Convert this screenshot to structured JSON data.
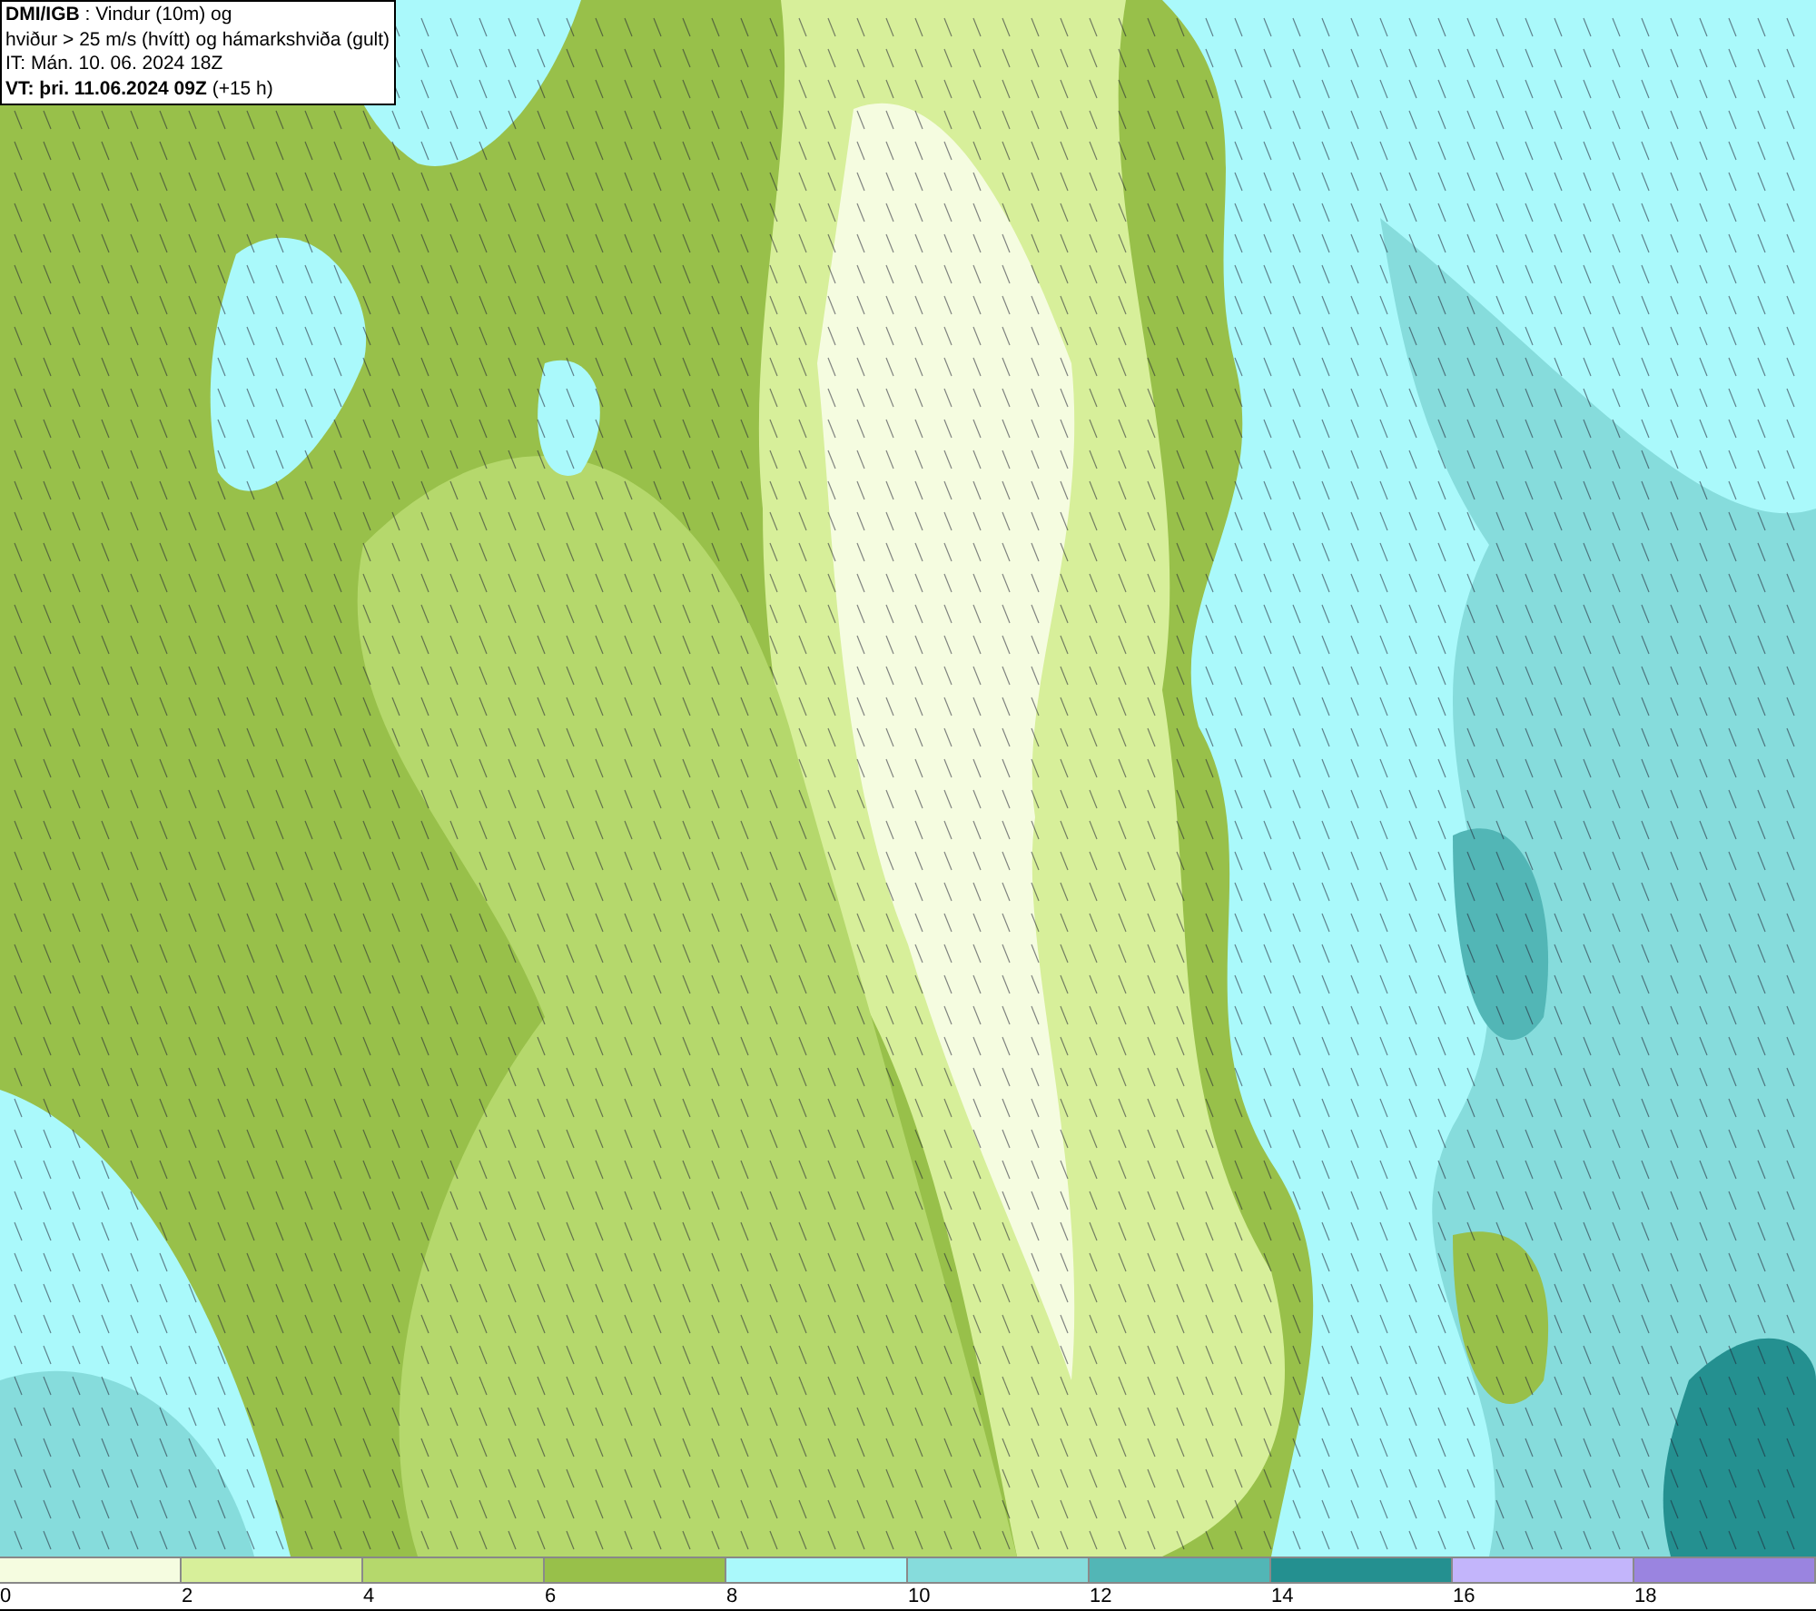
{
  "title_box": {
    "lines": [
      "**DMI/IGB** : Vindur (10m) og",
      "hviður > 25 m/s (hvítt) og hámarkshviða (gult)",
      "IT: Mán. 10. 06. 2024 18Z",
      "**VT: þri. 11.06.2024 09Z** (+15 h)"
    ]
  },
  "legend": {
    "bins": [
      {
        "color": "#f5fce0",
        "label": "0"
      },
      {
        "color": "#d7ef9a",
        "label": "2"
      },
      {
        "color": "#b5d86c",
        "label": "4"
      },
      {
        "color": "#98c04a",
        "label": "6"
      },
      {
        "color": "#aaf9fb",
        "label": "8"
      },
      {
        "color": "#86dcdc",
        "label": "10"
      },
      {
        "color": "#52b6b6",
        "label": "12"
      },
      {
        "color": "#249090",
        "label": "14"
      },
      {
        "color": "#c3b5fb",
        "label": "16"
      },
      {
        "color": "#9a84e0",
        "label": "18"
      }
    ]
  }
}
